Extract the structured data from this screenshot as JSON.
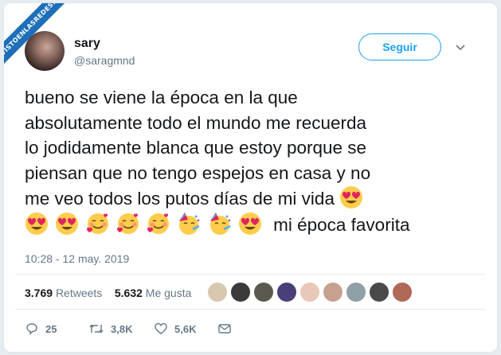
{
  "watermark": "VISTOENLASREDES.COM",
  "user": {
    "name": "sary",
    "handle": "@saragmnd"
  },
  "follow_label": "Seguir",
  "tweet": {
    "lines": [
      "bueno se viene la época en la que",
      "absolutamente todo el mundo me recuerda",
      "lo jodidamente blanca que estoy porque se",
      "piensan que no tengo espejos en casa y no",
      "me veo todos los putos días de mi vida"
    ],
    "last_text": "mi época favorita"
  },
  "timestamp": "10:28 - 12 may. 2019",
  "stats": {
    "retweets_count": "3.769",
    "retweets_label": "Retweets",
    "likes_count": "5.632",
    "likes_label": "Me gusta"
  },
  "actions": {
    "replies": "25",
    "retweets": "3,8K",
    "likes": "5,6K"
  },
  "colors": {
    "accent": "#1da1f2",
    "text": "#14171a",
    "muted": "#657786"
  }
}
